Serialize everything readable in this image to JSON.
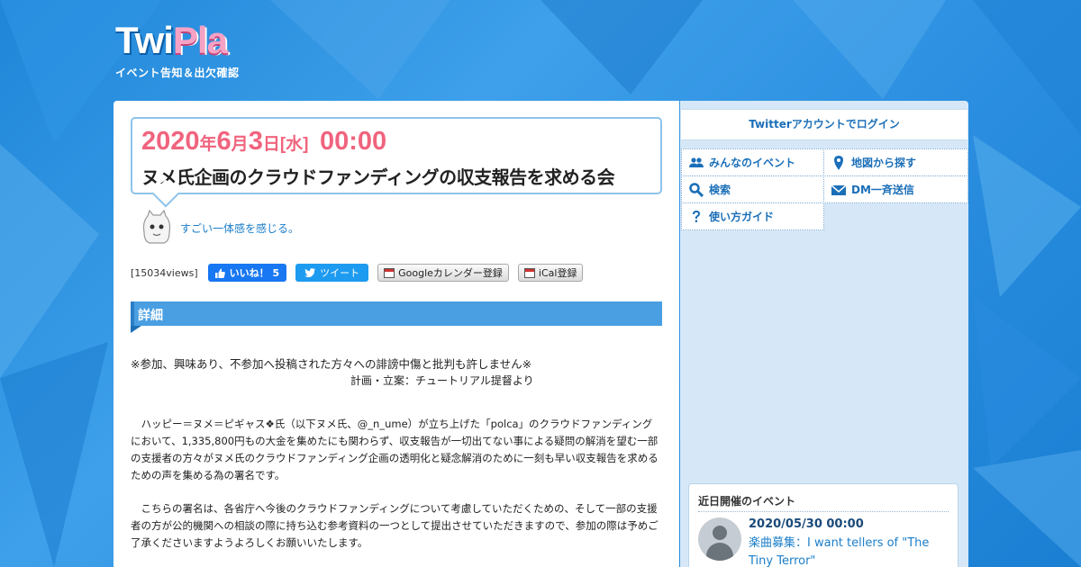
{
  "logo": {
    "part1": "Twi",
    "part2": "Pla",
    "tagline": "イベント告知＆出欠確認"
  },
  "event": {
    "year": "2020",
    "year_suffix": "年",
    "month": "6",
    "month_suffix": "月",
    "day": "3",
    "day_suffix": "日",
    "weekday": "[水]",
    "time": "00:00",
    "title": "ヌメ氏企画のクラウドファンディングの収支報告を求める会"
  },
  "organizer": {
    "comment": "すごい一体感を感じる。"
  },
  "share": {
    "views": "[15034views]",
    "like_label": "いいね！ 5",
    "tweet_label": "ツイート",
    "google_cal_label": "Googleカレンダー登録",
    "ical_label": "iCal登録"
  },
  "detail": {
    "heading": "詳細",
    "notice": "※参加、興味あり、不参加へ投稿された方々への誹謗中傷と批判も許しません※",
    "credit": "計画・立案：チュートリアル提督より",
    "paragraph1": "　ハッピー＝ヌメ＝ピギャス❖氏（以下ヌメ氏、@_n_ume）が立ち上げた「polca」のクラウドファンディングにおいて、1,335,800円もの大金を集めたにも関わらず、収支報告が一切出てない事による疑問の解消を望む一部の支援者の方々がヌメ氏のクラウドファンディング企画の透明化と疑念解消のために一刻も早い収支報告を求めるための声を集める為の署名です。",
    "paragraph2": "　こちらの署名は、各省庁へ今後のクラウドファンディングについて考慮していただくための、そして一部の支援者の方が公的機関への相談の際に持ち込む参考資料の一つとして提出させていただきますので、参加の際は予めご了承くださいますようよろしくお願いいたします。"
  },
  "sidebar": {
    "login": "Twitterアカウントでログイン",
    "menu": [
      {
        "label": "みんなのイベント",
        "icon": "users-icon"
      },
      {
        "label": "地図から探す",
        "icon": "map-pin-icon"
      },
      {
        "label": "検索",
        "icon": "search-icon"
      },
      {
        "label": "DM一斉送信",
        "icon": "mail-icon"
      },
      {
        "label": "使い方ガイド",
        "icon": "help-icon"
      }
    ],
    "upcoming": {
      "title": "近日開催のイベント",
      "date": "2020/05/30 00:00",
      "link": "楽曲募集：I want tellers of \"The Tiny Terror\""
    }
  },
  "colors": {
    "accent_blue": "#1b6fb8",
    "date_pink": "#f0647e",
    "heading_bar": "#4a9fe2"
  }
}
